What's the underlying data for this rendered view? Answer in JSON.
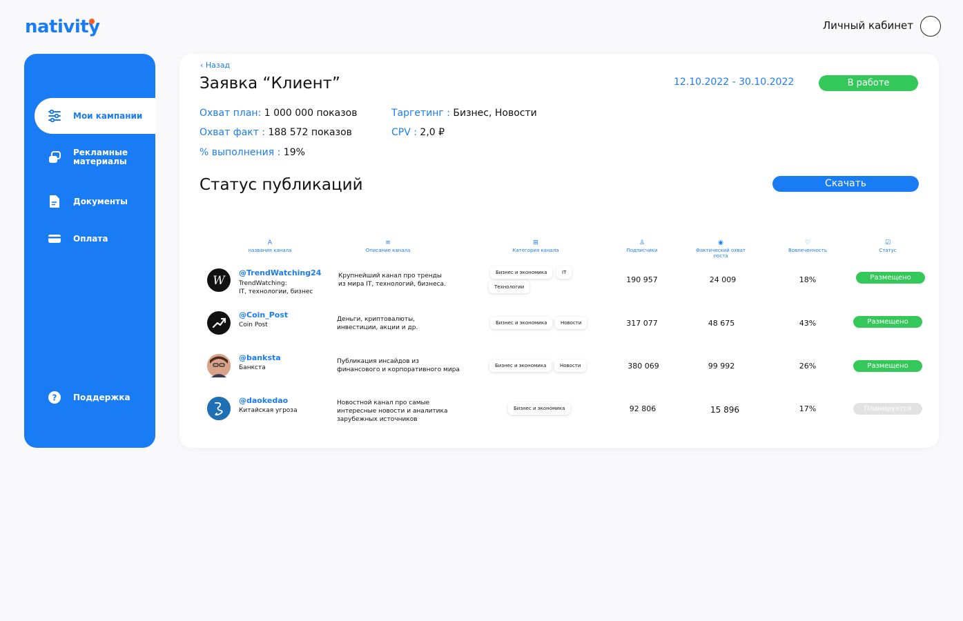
{
  "header": {
    "logo_text": "nativity",
    "cabinet_label": "Личный кабинет"
  },
  "sidebar": {
    "items": [
      {
        "label": "Мои кампании",
        "icon": "sliders-icon",
        "active": true
      },
      {
        "label": "Рекламные материалы",
        "icon": "layers-icon"
      },
      {
        "label": "Документы",
        "icon": "document-icon"
      },
      {
        "label": "Оплата",
        "icon": "card-icon"
      },
      {
        "label": "Поддержка",
        "icon": "question-icon"
      }
    ]
  },
  "order": {
    "back_label": "Назад",
    "title": "Заявка “Клиент”",
    "dates": "12.10.2022 - 30.10.2022",
    "status": "В работе",
    "reach_plan_key": "Охват план:",
    "reach_plan_value": " 1 000 000 показов",
    "reach_fact_key": "Охват факт :",
    "reach_fact_value": " 188 572 показов",
    "completion_key": "% выполнения :",
    "completion_value": " 19%",
    "targeting_key": "Таргетинг :",
    "targeting_value": " Бизнес, Новости",
    "cpv_key": "CPV :",
    "cpv_value": " 2,0 ₽"
  },
  "publications": {
    "title": "Статус публикаций",
    "download_label": "Скачать",
    "columns": [
      {
        "icon": "A",
        "label": "название канала"
      },
      {
        "icon": "≡",
        "label": "Описание канала"
      },
      {
        "icon": "⊞",
        "label": "Категория канала"
      },
      {
        "icon": "♙",
        "label": "Подписчики"
      },
      {
        "icon": "◉",
        "label": "Фактический охват поста"
      },
      {
        "icon": "♡",
        "label": "Вовлеченность"
      },
      {
        "icon": "☑",
        "label": "Статус"
      }
    ],
    "rows": [
      {
        "handle": "@TrendWatching24",
        "sub1": "TrendWatching:",
        "sub2": "IT, технологии, бизнес",
        "desc1": "Крупнейший канал про тренды",
        "desc2": "из мира IT, технологий, бизнеса.",
        "desc3": "",
        "tags": [
          "Бизнес и экономика",
          "IT",
          "Технологии"
        ],
        "subs": "190 957",
        "reach": "24 009",
        "engagement": "18%",
        "status": "Размещено"
      },
      {
        "handle": "@Coin_Post",
        "sub1": "Coin Post",
        "sub2": "",
        "desc1": "Деньги, криптовалюты,",
        "desc2": "инвестиции, акции и др.",
        "desc3": "",
        "tags": [
          "Бизнес и экономика",
          "Новости"
        ],
        "subs": "317 077",
        "reach": "48 675",
        "engagement": "43%",
        "status": "Размещено"
      },
      {
        "handle": "@banksta",
        "sub1": "Банкста",
        "sub2": "",
        "desc1": "Публикация инсайдов из",
        "desc2": "финансового и корпоративного мира",
        "desc3": "",
        "tags": [
          "Бизнес и экономика",
          "Новости"
        ],
        "subs": "380 069",
        "reach": "99 992",
        "engagement": "26%",
        "status": "Размещено"
      },
      {
        "handle": "@daokedao",
        "sub1": "Китайская угроза",
        "sub2": "",
        "desc1": "Новостной канал про самые",
        "desc2": "интересные новости и аналитика",
        "desc3": "зарубежных источников",
        "tags": [
          "Бизнес и экономика"
        ],
        "subs": "92 806",
        "reach": "15 896",
        "engagement": "17%",
        "status": "Планируется"
      }
    ]
  },
  "colors": {
    "accent": "#1a7cf5",
    "success": "#34c759",
    "muted": "#e2e2e2",
    "logo_dot": "#ff5a1f"
  }
}
